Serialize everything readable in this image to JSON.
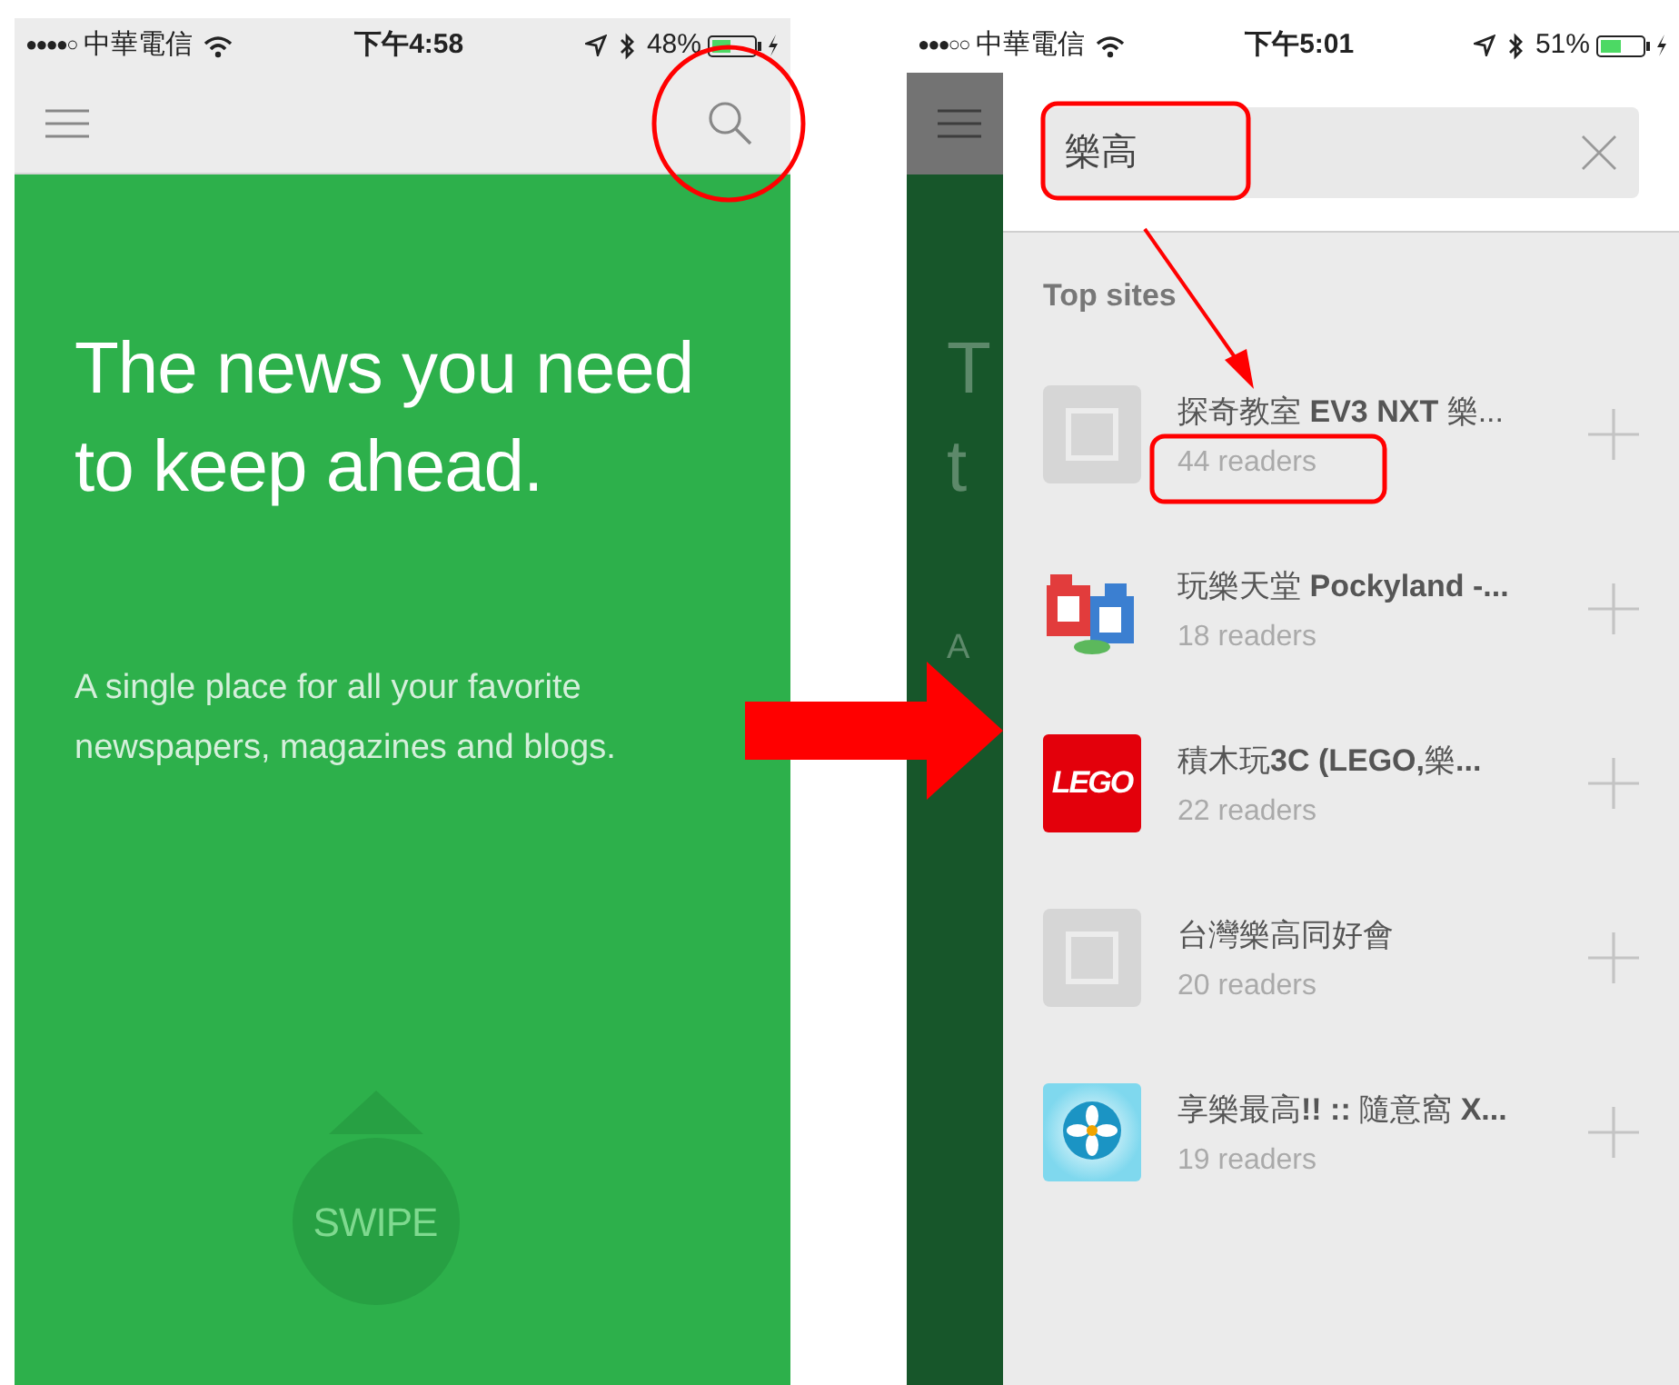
{
  "left_screen": {
    "status_bar": {
      "signal": "●●●●○",
      "carrier": "中華電信",
      "time": "下午4:58",
      "battery": "48%"
    },
    "headline": "The news you need to keep ahead.",
    "subtitle": "A single place for all your favorite newspapers, magazines and blogs.",
    "swipe_button": "SWIPE"
  },
  "right_screen": {
    "status_bar": {
      "signal": "●●●○○",
      "carrier": "中華電信",
      "time": "下午5:01",
      "battery": "51%"
    },
    "background_peek": [
      "T",
      "t",
      "A"
    ],
    "search": {
      "value": "樂高"
    },
    "section_title": "Top sites",
    "sites": [
      {
        "kind": "placeholder",
        "title": "探奇教室 **EV3 NXT** 樂...",
        "readers": "44 readers"
      },
      {
        "kind": "blocks",
        "title": "玩樂天堂 **Pockyland -...**",
        "readers": "18 readers"
      },
      {
        "kind": "logo",
        "logo_text": "LEGO",
        "title": "積木玩**3C (LEGO,**樂**...**",
        "readers": "22 readers"
      },
      {
        "kind": "placeholder",
        "title": "台灣樂高同好會",
        "readers": "20 readers"
      },
      {
        "kind": "flower",
        "title": "享樂最高**!! ::** 隨意窩 **X...**",
        "readers": "19 readers"
      }
    ]
  }
}
